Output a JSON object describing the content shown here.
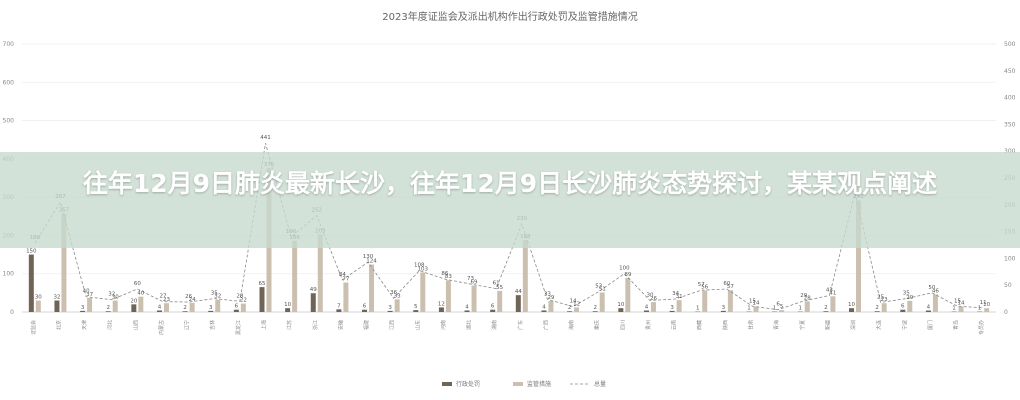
{
  "overlay": {
    "headline": "往年12月9日肺炎最新长沙，往年12月9日长沙肺炎态势探讨，某某观点阐述"
  },
  "colors": {
    "series1": "#6f6456",
    "series2": "#cbbfaf",
    "line": "#888888",
    "grid": "#eeeeee",
    "overlay": "#c6dace"
  },
  "chart_data": {
    "type": "bar",
    "title": "2023年度证监会及派出机构作出行政处罚及监管措施情况",
    "ylim": [
      0,
      700
    ],
    "y_ticks": [
      0,
      100,
      200,
      300,
      400,
      500,
      600,
      700
    ],
    "y2_ticks": [
      0,
      50,
      100,
      150,
      200,
      250,
      300,
      350,
      400,
      450,
      500
    ],
    "grid": true,
    "legend_position": "bottom",
    "legend": [
      "行政处罚",
      "监管措施",
      "总量"
    ],
    "categories": [
      "证监会",
      "北京",
      "天津",
      "河北",
      "山西",
      "内蒙古",
      "辽宁",
      "吉林",
      "黑龙江",
      "上海",
      "江苏",
      "浙江",
      "安徽",
      "福建",
      "江西",
      "山东",
      "河南",
      "湖北",
      "湖南",
      "广东",
      "广西",
      "海南",
      "重庆",
      "四川",
      "贵州",
      "云南",
      "西藏",
      "陕西",
      "甘肃",
      "青海",
      "宁夏",
      "新疆",
      "深圳",
      "大连",
      "宁波",
      "厦门",
      "青岛",
      "专员办"
    ],
    "series": [
      {
        "name": "行政处罚",
        "values": [
          150,
          30,
          3,
          2,
          20,
          4,
          2,
          3,
          6,
          65,
          10,
          49,
          7,
          6,
          3,
          5,
          12,
          4,
          6,
          44,
          4,
          2,
          2,
          10,
          4,
          3,
          1,
          3,
          1,
          1,
          1,
          2,
          10,
          2,
          6,
          4,
          1,
          1
        ]
      },
      {
        "name": "监管措施",
        "values": [
          30,
          257,
          37,
          30,
          40,
          23,
          24,
          32,
          22,
          376,
          186,
          203,
          77,
          124,
          33,
          103,
          83,
          69,
          55,
          188,
          29,
          12,
          51,
          89,
          26,
          31,
          56,
          57,
          14,
          5,
          28,
          41,
          292,
          23,
          29,
          46,
          14,
          10
        ]
      },
      {
        "name": "总量",
        "values": [
          180,
          287,
          40,
          32,
          60,
          27,
          26,
          35,
          28,
          441,
          196,
          252,
          84,
          130,
          36,
          108,
          86,
          73,
          61,
          230,
          33,
          14,
          53,
          100,
          30,
          34,
          57,
          60,
          15,
          6,
          29,
          43,
          310,
          25,
          35,
          50,
          15,
          11
        ]
      }
    ],
    "data_labels_series1": [
      "150",
      "32",
      "3",
      "2",
      "20",
      "4",
      "2",
      "3",
      "6",
      "65",
      "10",
      "49",
      "7",
      "6",
      "3",
      "5",
      "12",
      "4",
      "6",
      "44",
      "4",
      "2",
      "2",
      "10",
      "4",
      "3",
      "1",
      "3",
      "1",
      "1",
      "1",
      "2",
      "10",
      "2",
      "6",
      "4",
      "1",
      "1"
    ],
    "data_labels_series2": [
      "30",
      "257",
      "37",
      "30",
      "40",
      "23",
      "24",
      "32",
      "22",
      "376",
      "186",
      "203",
      "77",
      "124",
      "33",
      "103",
      "83",
      "69",
      "55",
      "188",
      "29",
      "12",
      "51",
      "89",
      "26",
      "31",
      "56",
      "57",
      "14",
      "5",
      "28",
      "41",
      "292",
      "23",
      "29",
      "46",
      "14",
      "10"
    ]
  }
}
